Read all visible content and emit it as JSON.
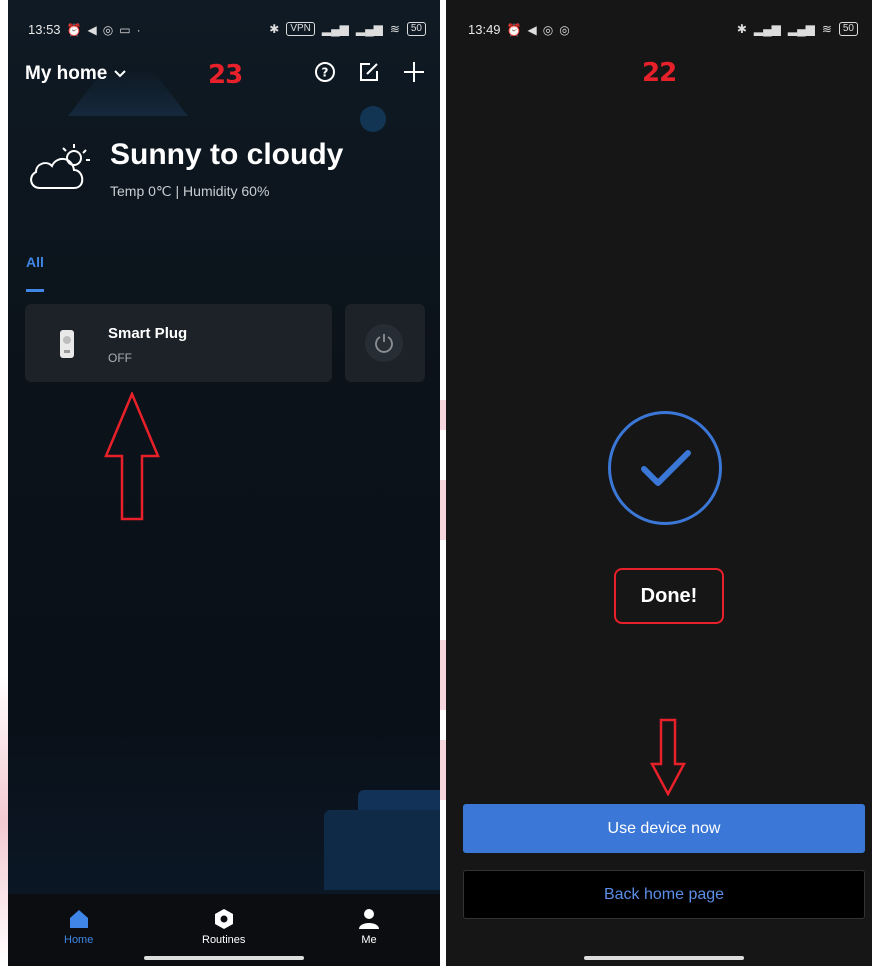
{
  "colors": {
    "accent": "#3b77d6",
    "annotation_red": "#e8202a",
    "card": "#1c2228"
  },
  "left": {
    "status": {
      "time": "13:53",
      "vpn": "VPN",
      "battery": "50"
    },
    "step_number": "23",
    "home_title": "My home",
    "weather": {
      "title": "Sunny to cloudy",
      "details": "Temp 0℃ | Humidity 60%"
    },
    "tabs": [
      {
        "label": "All"
      }
    ],
    "device": {
      "name": "Smart Plug",
      "state": "OFF"
    },
    "nav": [
      {
        "label": "Home",
        "icon": "home-icon"
      },
      {
        "label": "Routines",
        "icon": "routines-icon"
      },
      {
        "label": "Me",
        "icon": "person-icon"
      }
    ]
  },
  "right": {
    "status": {
      "time": "13:49",
      "battery": "50"
    },
    "step_number": "22",
    "done_label": "Done!",
    "use_device_label": "Use device now",
    "back_home_label": "Back home page"
  }
}
